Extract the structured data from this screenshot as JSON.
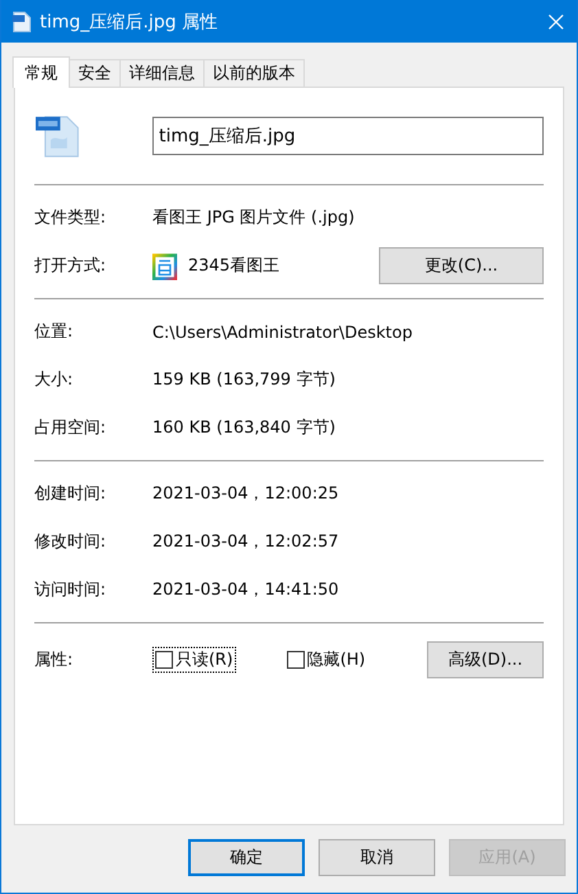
{
  "window": {
    "title": "timg_压缩后.jpg 属性"
  },
  "tabs": [
    {
      "label": "常规",
      "selected": true
    },
    {
      "label": "安全",
      "selected": false
    },
    {
      "label": "详细信息",
      "selected": false
    },
    {
      "label": "以前的版本",
      "selected": false
    }
  ],
  "file_name": {
    "value": "timg_压缩后.jpg"
  },
  "file_type": {
    "label": "文件类型:",
    "value": "看图王 JPG 图片文件 (.jpg)"
  },
  "opens_with": {
    "label": "打开方式:",
    "app": "2345看图王",
    "button": "更改(C)..."
  },
  "location_rows": [
    {
      "label": "位置:",
      "value": "C:\\Users\\Administrator\\Desktop"
    },
    {
      "label": "大小:",
      "value": "159 KB (163,799 字节)"
    },
    {
      "label": "占用空间:",
      "value": "160 KB (163,840 字节)"
    }
  ],
  "time_rows": [
    {
      "label": "创建时间:",
      "value": "2021-03-04，12:00:25"
    },
    {
      "label": "修改时间:",
      "value": "2021-03-04，12:02:57"
    },
    {
      "label": "访问时间:",
      "value": "2021-03-04，14:41:50"
    }
  ],
  "attributes": {
    "label": "属性:",
    "checkboxes": [
      {
        "label": "只读(R)",
        "checked": false,
        "focused": true
      },
      {
        "label": "隐藏(H)",
        "checked": false,
        "focused": false
      }
    ],
    "button": "高级(D)..."
  },
  "buttons": [
    {
      "label": "确定",
      "default": true,
      "disabled": false
    },
    {
      "label": "取消",
      "default": false,
      "disabled": false
    },
    {
      "label": "应用(A)",
      "default": false,
      "disabled": true
    }
  ]
}
